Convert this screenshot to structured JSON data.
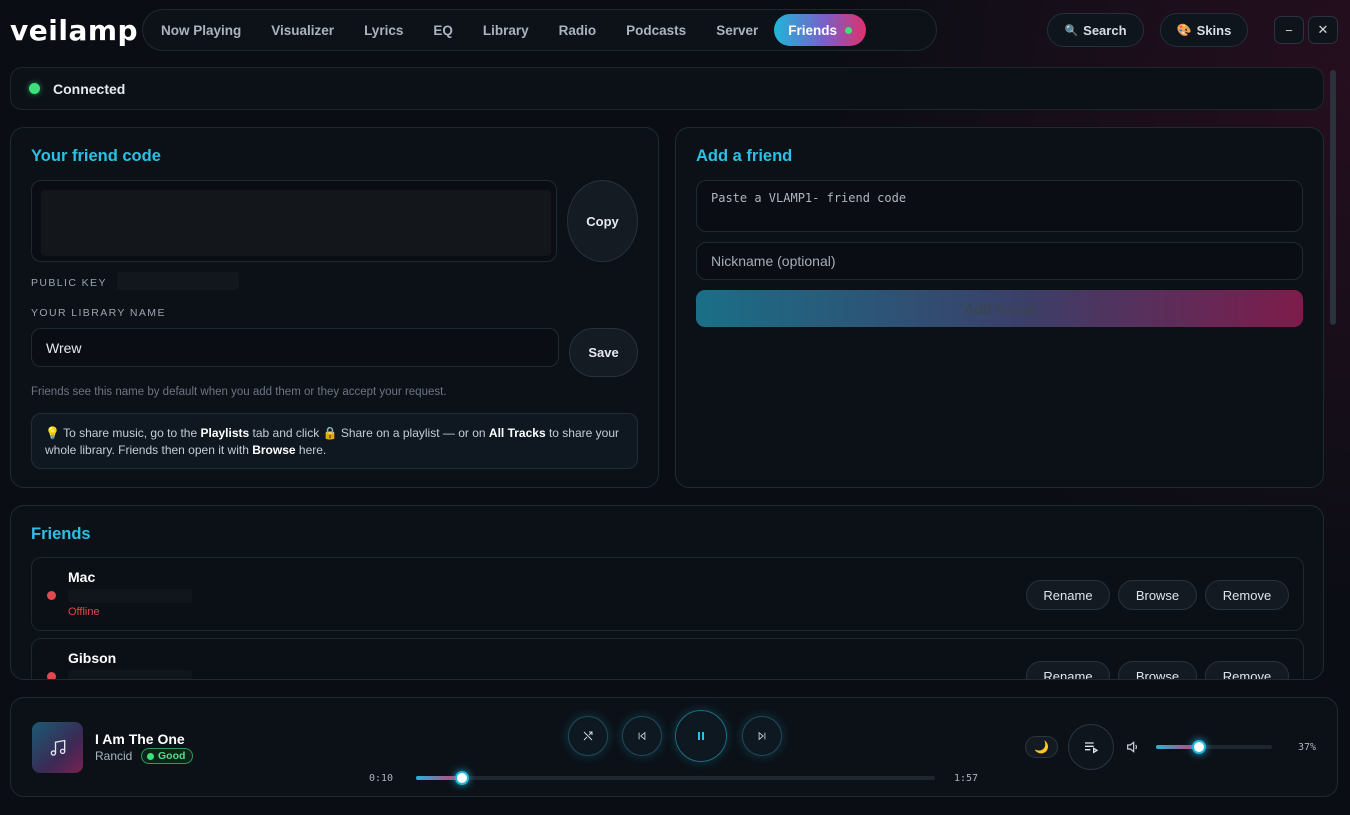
{
  "app": {
    "logo": "veilamp"
  },
  "nav": {
    "tabs": [
      {
        "label": "Now Playing"
      },
      {
        "label": "Visualizer"
      },
      {
        "label": "Lyrics"
      },
      {
        "label": "EQ"
      },
      {
        "label": "Library"
      },
      {
        "label": "Radio"
      },
      {
        "label": "Podcasts"
      },
      {
        "label": "Server"
      },
      {
        "label": "Friends",
        "active": true
      }
    ]
  },
  "header": {
    "search_label": "Search",
    "skins_label": "Skins",
    "search_icon": "🔍",
    "skins_icon": "🎨",
    "minimize": "−",
    "close": "✕"
  },
  "connection": {
    "status": "Connected",
    "color": "#3ee07a"
  },
  "friend_code": {
    "title": "Your friend code",
    "copy_label": "Copy",
    "public_key_label": "PUBLIC KEY",
    "library_name_label": "YOUR LIBRARY NAME",
    "library_name_value": "Wrew",
    "save_label": "Save",
    "hint": "Friends see this name by default when you add them or they accept your request.",
    "tip": {
      "icon": "💡",
      "t1": " To share music, go to the ",
      "b1": "Playlists",
      "t2": " tab and click 🔒 Share on a playlist — or on ",
      "b2": "All Tracks",
      "t3": " to share your whole library. Friends then open it with ",
      "b3": "Browse",
      "t4": " here."
    }
  },
  "add_friend": {
    "title": "Add a friend",
    "code_placeholder": "Paste a VLAMP1- friend code",
    "nickname_placeholder": "Nickname (optional)",
    "add_label": "Add friend"
  },
  "friends": {
    "title": "Friends",
    "rename_label": "Rename",
    "browse_label": "Browse",
    "remove_label": "Remove",
    "list": [
      {
        "name": "Mac",
        "status": "Offline"
      },
      {
        "name": "Gibson",
        "status": ""
      }
    ]
  },
  "player": {
    "title": "I Am The One",
    "artist": "Rancid",
    "quality": "Good",
    "elapsed": "0:10",
    "duration": "1:57",
    "progress": 0.088,
    "volume_pct": 37,
    "volume_label": "37%",
    "moon_icon": "🌙"
  },
  "colors": {
    "accent": "#2bc0e4",
    "accent2": "#e0306e",
    "offline": "#e2484e"
  }
}
